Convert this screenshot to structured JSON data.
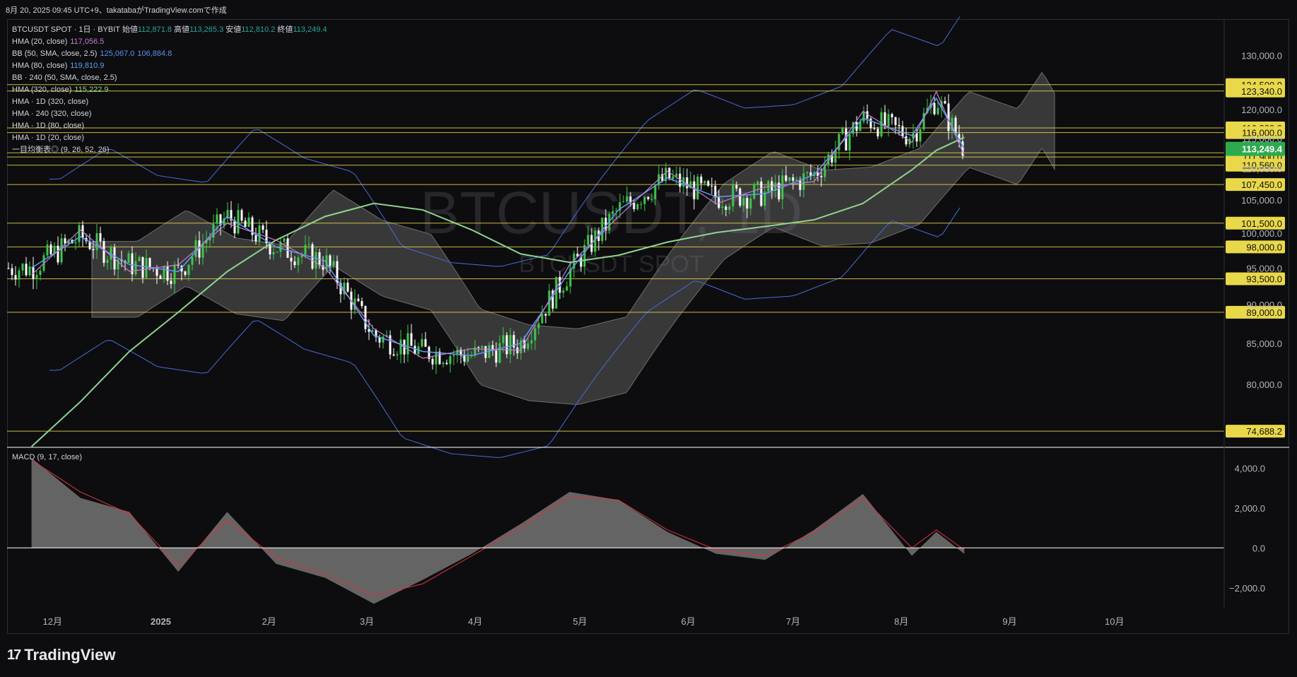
{
  "header": {
    "text": "8月 20, 2025 09:45 UTC+9、takatabaがTradingView.comで作成"
  },
  "legend": [
    {
      "label": "BTCUSDT SPOT · 1日 · BYBIT",
      "parts": [
        {
          "k": "始値",
          "v": "112,871.8"
        },
        {
          "k": "高値",
          "v": "113,265.3"
        },
        {
          "k": "安値",
          "v": "112,810.2"
        },
        {
          "k": "終値",
          "v": "113,249.4"
        }
      ],
      "color": "#26a69a"
    },
    {
      "label": "HMA (20, close)",
      "values": [
        "117,056.5"
      ],
      "color": "#c77dd1"
    },
    {
      "label": "BB (50, SMA, close, 2.5)",
      "values": [
        "125,067.0",
        "106,884.8"
      ],
      "color": "#5b8ff0"
    },
    {
      "label": "HMA (80, close)",
      "values": [
        "119,810.9"
      ],
      "color": "#5b9ff0"
    },
    {
      "label": "BB · 240 (50, SMA, close, 2.5)",
      "values": [],
      "color": "#5b8ff0"
    },
    {
      "label": "HMA (320, close)",
      "values": [
        "115,222.9"
      ],
      "color": "#8fd48f"
    },
    {
      "label": "HMA · 1D (320, close)",
      "values": [],
      "color": "#8fd48f"
    },
    {
      "label": "HMA · 240 (320, close)",
      "values": [],
      "color": "#8fd48f"
    },
    {
      "label": "HMA · 1D (80, close)",
      "values": [],
      "color": "#8fd48f"
    },
    {
      "label": "HMA · 1D (20, close)",
      "values": [],
      "color": "#8fd48f"
    },
    {
      "label": "一目均衡表◎ (9, 26, 52, 26)",
      "values": [],
      "color": "#8fd48f"
    }
  ],
  "watermark": {
    "big": "BTCUSDT, 1D",
    "small": "BTCUSDT SPOT"
  },
  "macd_title": "MACD (9, 17, close)",
  "brand": "TradingView",
  "colors": {
    "bg": "#0d0d0f",
    "up": "#3ec84a",
    "down": "#ffffff",
    "level": "#e8d84a",
    "hma20": "#c77dd1",
    "hma80": "#5b9ff0",
    "hma320": "#8fd48f",
    "bb": "#4a6ad8",
    "cloud": "#8a8a8a",
    "macd": "#e0323c"
  },
  "chart_data": [
    {
      "type": "line",
      "title": "BTCUSDT SPOT · 1日 · BYBIT",
      "xlabel": "",
      "ylabel": "",
      "scale": "log",
      "ylim": [
        73000,
        137000
      ],
      "x": [
        "2024-11-25",
        "2024-12-09",
        "2024-12-23",
        "2025-01-06",
        "2025-01-20",
        "2025-02-03",
        "2025-02-17",
        "2025-03-03",
        "2025-03-17",
        "2025-03-31",
        "2025-04-14",
        "2025-04-28",
        "2025-05-12",
        "2025-05-26",
        "2025-06-09",
        "2025-06-23",
        "2025-07-07",
        "2025-07-21",
        "2025-08-04",
        "2025-08-11",
        "2025-08-19"
      ],
      "series": [
        {
          "name": "BTCUSDT",
          "values": [
            95000,
            99500,
            95500,
            94500,
            102500,
            98000,
            96000,
            86000,
            84000,
            83500,
            85000,
            94500,
            103500,
            108500,
            105500,
            106000,
            109000,
            118500,
            115500,
            122000,
            113249
          ]
        },
        {
          "name": "HMA (320, close)",
          "values": [
            73000,
            78000,
            84000,
            89000,
            94500,
            99000,
            102500,
            104500,
            103500,
            100500,
            97000,
            95800,
            96800,
            98700,
            100100,
            101000,
            102000,
            104500,
            109800,
            113000,
            115200
          ]
        }
      ],
      "x_ticks": [
        "12月",
        "2025",
        "2月",
        "3月",
        "4月",
        "5月",
        "6月",
        "7月",
        "8月",
        "9月",
        "10月"
      ],
      "y_ticks": [
        "130,000.0",
        "120,000.0",
        "115,000.0",
        "110,000.0",
        "105,000.0",
        "100,000.0",
        "95,000.0",
        "90,000.0",
        "85,000.0",
        "80,000.0"
      ],
      "levels": [
        "124,500.0",
        "123,340.0",
        "116,800.0",
        "116,000.0",
        "112,600.0",
        "111,900.0",
        "110,560.0",
        "107,450.0",
        "101,500.0",
        "98,000.0",
        "93,500.0",
        "89,000.0",
        "74,688.2"
      ],
      "last_price": "113,249.4",
      "grid": false
    },
    {
      "type": "area",
      "title": "MACD (9, 17, close)",
      "ylim": [
        -3000,
        5000
      ],
      "y_ticks": [
        "4,000.0",
        "2,000.0",
        "0.0",
        "−2,000.0"
      ],
      "x": [
        "2024-11-25",
        "2024-12-09",
        "2024-12-23",
        "2025-01-06",
        "2025-01-20",
        "2025-02-03",
        "2025-02-17",
        "2025-03-03",
        "2025-03-17",
        "2025-03-31",
        "2025-04-14",
        "2025-04-28",
        "2025-05-12",
        "2025-05-26",
        "2025-06-09",
        "2025-06-23",
        "2025-07-07",
        "2025-07-21",
        "2025-08-04",
        "2025-08-11",
        "2025-08-19"
      ],
      "series": [
        {
          "name": "MACD",
          "values": [
            4500,
            2500,
            1800,
            -1200,
            1800,
            -800,
            -1500,
            -2800,
            -1600,
            -300,
            1200,
            2800,
            2400,
            800,
            -300,
            -600,
            900,
            2700,
            -400,
            800,
            -300
          ]
        },
        {
          "name": "Signal",
          "values": [
            4400,
            2800,
            1700,
            -900,
            1400,
            -500,
            -1300,
            -2400,
            -1800,
            -400,
            1000,
            2600,
            2400,
            900,
            -100,
            -400,
            800,
            2500,
            0,
            900,
            -100
          ]
        }
      ]
    }
  ]
}
